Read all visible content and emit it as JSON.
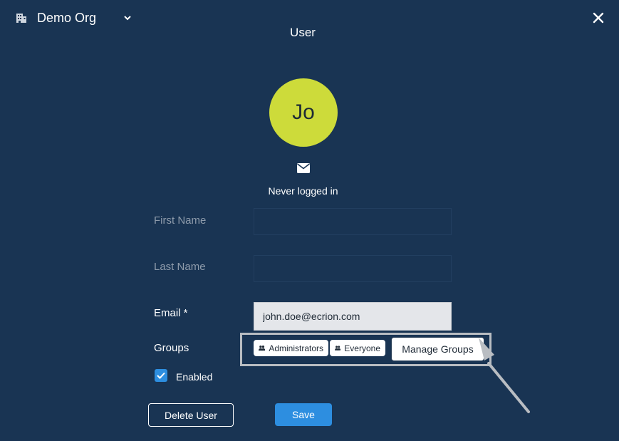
{
  "header": {
    "org_name": "Demo Org",
    "org_icon": "building-icon",
    "dropdown_icon": "chevron-down-icon",
    "close_icon": "close-icon",
    "title": "User"
  },
  "profile": {
    "avatar_initials": "Jo",
    "avatar_color": "#cddb3a",
    "email_icon": "envelope-icon",
    "last_login": "Never logged in"
  },
  "form": {
    "first_name_label": "First Name",
    "first_name_value": "",
    "last_name_label": "Last Name",
    "last_name_value": "",
    "email_label": "Email *",
    "email_value": "john.doe@ecrion.com",
    "groups_label": "Groups",
    "groups": [
      {
        "name": "Administrators",
        "icon": "group-icon"
      },
      {
        "name": "Everyone",
        "icon": "group-icon"
      }
    ],
    "manage_groups_label": "Manage Groups",
    "enabled_label": "Enabled",
    "enabled": true
  },
  "actions": {
    "delete_label": "Delete User",
    "save_label": "Save"
  },
  "colors": {
    "background": "#193453",
    "accent": "#2d8ee0"
  }
}
